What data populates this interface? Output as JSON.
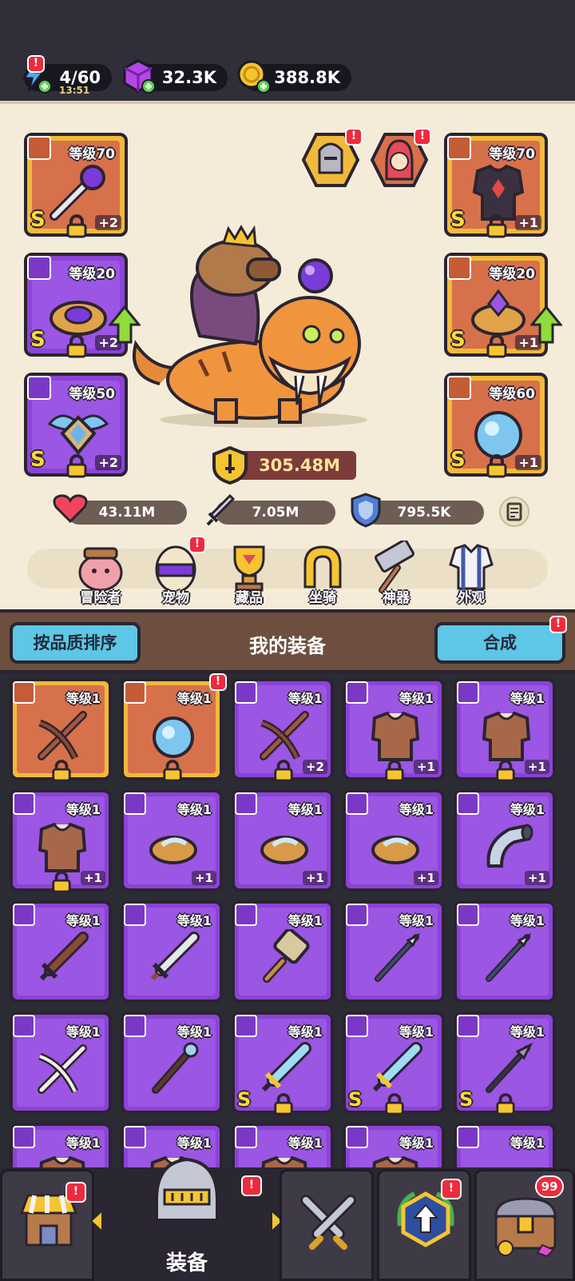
{
  "resources": {
    "energy": {
      "value": "4/60",
      "timer": "13:51"
    },
    "gems": {
      "value": "32.3K"
    },
    "coins": {
      "value": "388.8K"
    }
  },
  "equipment_slots": [
    {
      "level": "等级70",
      "grade": "S",
      "plus": "+2",
      "rarity": "gold",
      "type": "weapon",
      "item": "orb-staff"
    },
    {
      "level": "等级20",
      "grade": "S",
      "plus": "+2",
      "rarity": "purple",
      "type": "ring",
      "item": "ring"
    },
    {
      "level": "等级50",
      "grade": "S",
      "plus": "+2",
      "rarity": "purple",
      "type": "necklace",
      "item": "winged-emblem"
    },
    {
      "level": "等级70",
      "grade": "S",
      "plus": "+1",
      "rarity": "gold",
      "type": "armor",
      "item": "dark-armor"
    },
    {
      "level": "等级20",
      "grade": "S",
      "plus": "+1",
      "rarity": "gold",
      "type": "ring",
      "item": "gem-ring"
    },
    {
      "level": "等级60",
      "grade": "S",
      "plus": "+1",
      "rarity": "gold",
      "type": "necklace",
      "item": "ice-orb"
    }
  ],
  "power": "305.48M",
  "stats": {
    "hp": "43.11M",
    "attack": "7.05M",
    "defense": "795.5K"
  },
  "menu": [
    "冒险者",
    "宠物",
    "藏品",
    "坐骑",
    "神器",
    "外观"
  ],
  "inventory_bar": {
    "sort_button": "按品质排序",
    "title": "我的装备",
    "merge_button": "合成"
  },
  "inventory": [
    {
      "level": "等级1",
      "rarity": "gold",
      "type": "weapon",
      "item": "crossbow",
      "plus": "",
      "grade": "",
      "locked": true
    },
    {
      "level": "等级1",
      "rarity": "gold",
      "type": "necklace",
      "item": "ice-orb",
      "plus": "",
      "grade": "",
      "locked": true
    },
    {
      "level": "等级1",
      "rarity": "purple",
      "type": "weapon",
      "item": "crossbow",
      "plus": "+2",
      "grade": "",
      "locked": true
    },
    {
      "level": "等级1",
      "rarity": "purple",
      "type": "armor",
      "item": "leather-armor",
      "plus": "+1",
      "grade": "",
      "locked": true
    },
    {
      "level": "等级1",
      "rarity": "purple",
      "type": "armor",
      "item": "leather-armor",
      "plus": "+1",
      "grade": "",
      "locked": true
    },
    {
      "level": "等级1",
      "rarity": "purple",
      "type": "armor",
      "item": "leather-armor",
      "plus": "+1",
      "grade": "",
      "locked": true
    },
    {
      "level": "等级1",
      "rarity": "purple",
      "type": "ring",
      "item": "ring",
      "plus": "+1",
      "grade": "",
      "locked": false
    },
    {
      "level": "等级1",
      "rarity": "purple",
      "type": "ring",
      "item": "ring",
      "plus": "+1",
      "grade": "",
      "locked": false
    },
    {
      "level": "等级1",
      "rarity": "purple",
      "type": "ring",
      "item": "ring",
      "plus": "+1",
      "grade": "",
      "locked": false
    },
    {
      "level": "等级1",
      "rarity": "purple",
      "type": "necklace",
      "item": "horn",
      "plus": "+1",
      "grade": "",
      "locked": false
    },
    {
      "level": "等级1",
      "rarity": "purple",
      "type": "weapon",
      "item": "wooden-sword",
      "plus": "",
      "grade": "",
      "locked": false
    },
    {
      "level": "等级1",
      "rarity": "purple",
      "type": "weapon",
      "item": "sword",
      "plus": "",
      "grade": "",
      "locked": false
    },
    {
      "level": "等级1",
      "rarity": "purple",
      "type": "weapon",
      "item": "hammer",
      "plus": "",
      "grade": "",
      "locked": false
    },
    {
      "level": "等级1",
      "rarity": "purple",
      "type": "weapon",
      "item": "spear",
      "plus": "",
      "grade": "",
      "locked": false
    },
    {
      "level": "等级1",
      "rarity": "purple",
      "type": "weapon",
      "item": "spear",
      "plus": "",
      "grade": "",
      "locked": false
    },
    {
      "level": "等级1",
      "rarity": "purple",
      "type": "weapon",
      "item": "bone-crossbow",
      "plus": "",
      "grade": "",
      "locked": false
    },
    {
      "level": "等级1",
      "rarity": "purple",
      "type": "weapon",
      "item": "staff",
      "plus": "",
      "grade": "",
      "locked": false
    },
    {
      "level": "等级1",
      "rarity": "purple",
      "type": "weapon",
      "item": "ice-sword",
      "plus": "",
      "grade": "S",
      "locked": true
    },
    {
      "level": "等级1",
      "rarity": "purple",
      "type": "weapon",
      "item": "ice-sword",
      "plus": "",
      "grade": "S",
      "locked": true
    },
    {
      "level": "等级1",
      "rarity": "purple",
      "type": "weapon",
      "item": "dark-spear",
      "plus": "",
      "grade": "S",
      "locked": true
    },
    {
      "level": "等级1",
      "rarity": "purple",
      "type": "armor",
      "item": "leather-armor",
      "plus": "",
      "grade": "",
      "locked": false
    },
    {
      "level": "等级1",
      "rarity": "purple",
      "type": "armor",
      "item": "leather-armor",
      "plus": "",
      "grade": "",
      "locked": false
    },
    {
      "level": "等级1",
      "rarity": "purple",
      "type": "armor",
      "item": "leather-armor",
      "plus": "",
      "grade": "",
      "locked": false
    },
    {
      "level": "等级1",
      "rarity": "purple",
      "type": "armor",
      "item": "leather-armor",
      "plus": "",
      "grade": "",
      "locked": false
    },
    {
      "level": "等级1",
      "rarity": "purple",
      "type": "ring",
      "item": "ring",
      "plus": "",
      "grade": "",
      "locked": false
    }
  ],
  "tabs": [
    {
      "name": "shop",
      "label": "",
      "alert": "!"
    },
    {
      "name": "equipment",
      "label": "装备",
      "alert": "!"
    },
    {
      "name": "battle",
      "label": "",
      "alert": ""
    },
    {
      "name": "upgrade",
      "label": "",
      "alert": "!"
    },
    {
      "name": "chest",
      "label": "",
      "badge": "99"
    }
  ],
  "alerts": {
    "energy": "!",
    "hero1": "!",
    "hero2": "!",
    "pet": "!",
    "merge": "!",
    "inv_gift": "!"
  },
  "colors": {
    "gold": "#f1b93a",
    "purple": "#8b43d8",
    "accent": "#5ec6e6",
    "alert": "#ee2b3c"
  }
}
